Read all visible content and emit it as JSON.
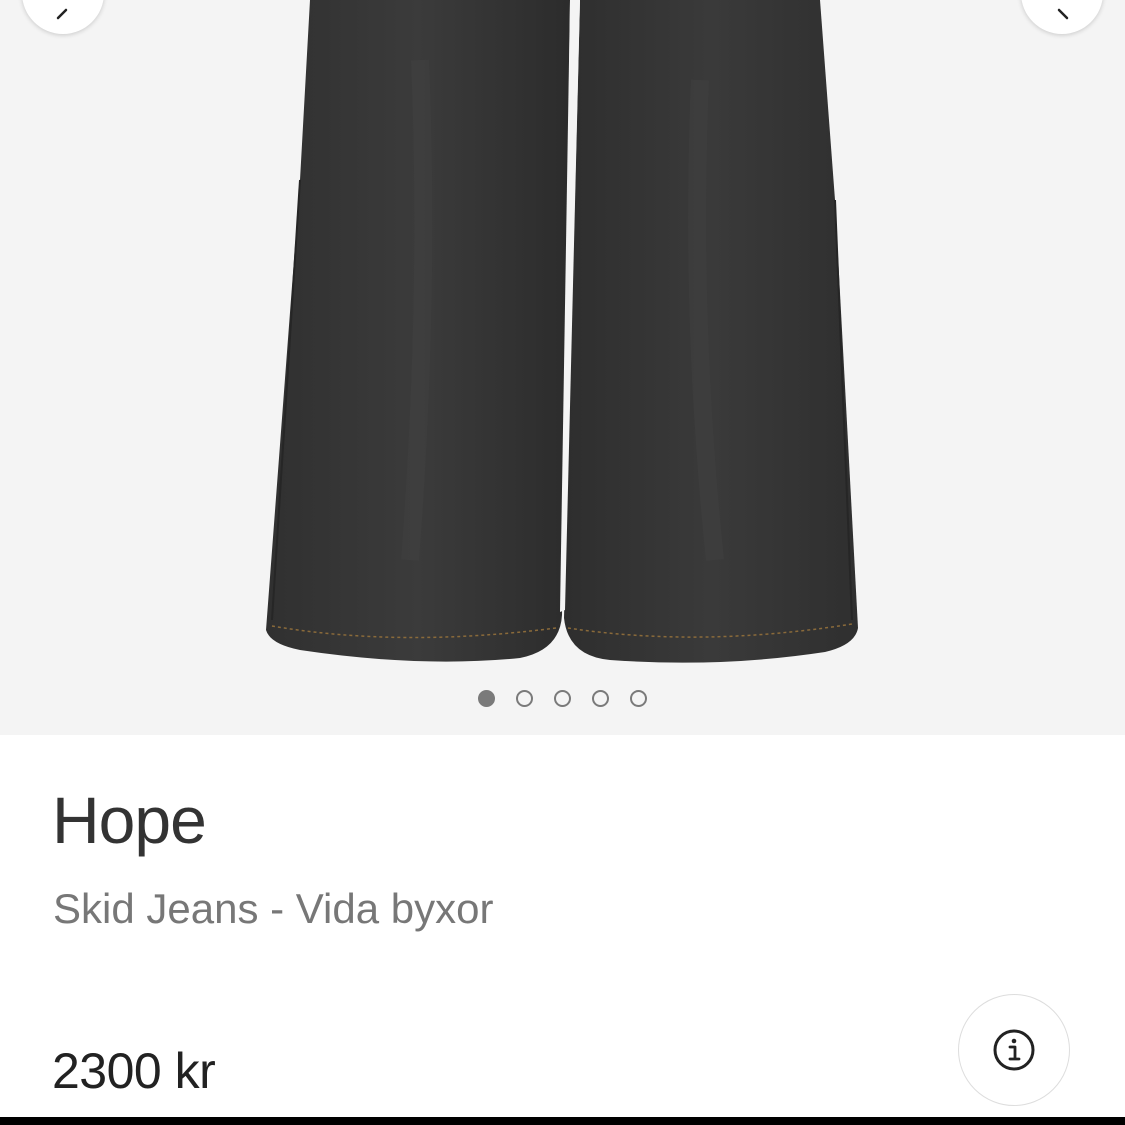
{
  "gallery": {
    "image": "wide-leg-black-jeans-photo",
    "slide_count": 5,
    "active_slide": 1,
    "prev_icon": "chevron-left-icon",
    "next_icon": "chevron-right-icon",
    "background_color": "#f4f4f4"
  },
  "product": {
    "brand": "Hope",
    "subtitle": "Skid Jeans - Vida byxor",
    "price": "2300 kr",
    "info_icon": "info-icon"
  },
  "colors": {
    "text_primary": "#333333",
    "text_secondary": "#777777",
    "dot": "#7a7a7a"
  }
}
